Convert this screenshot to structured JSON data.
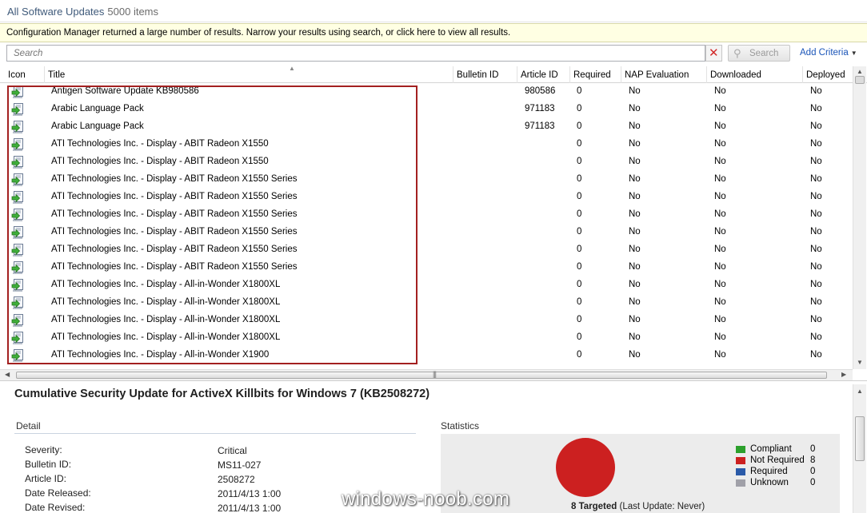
{
  "window": {
    "title": "All Software Updates",
    "count": "5000 items"
  },
  "infobar": {
    "text": "Configuration Manager returned a large number of results. Narrow your results using search, or click here to view all results."
  },
  "search": {
    "placeholder": "Search",
    "button_label": "Search",
    "add_criteria": "Add Criteria"
  },
  "columns": [
    "Icon",
    "Title",
    "Bulletin ID",
    "Article ID",
    "Required",
    "NAP Evaluation",
    "Downloaded",
    "Deployed"
  ],
  "rows": [
    {
      "title": "Antigen Software Update KB980586",
      "bulletin": "",
      "article": "980586",
      "required": "0",
      "nap": "No",
      "downloaded": "No",
      "deployed": "No"
    },
    {
      "title": "Arabic Language Pack",
      "bulletin": "",
      "article": "971183",
      "required": "0",
      "nap": "No",
      "downloaded": "No",
      "deployed": "No"
    },
    {
      "title": "Arabic Language Pack",
      "bulletin": "",
      "article": "971183",
      "required": "0",
      "nap": "No",
      "downloaded": "No",
      "deployed": "No"
    },
    {
      "title": "ATI Technologies Inc. - Display - ABIT Radeon X1550",
      "bulletin": "",
      "article": "",
      "required": "0",
      "nap": "No",
      "downloaded": "No",
      "deployed": "No"
    },
    {
      "title": "ATI Technologies Inc. - Display - ABIT Radeon X1550",
      "bulletin": "",
      "article": "",
      "required": "0",
      "nap": "No",
      "downloaded": "No",
      "deployed": "No"
    },
    {
      "title": "ATI Technologies Inc. - Display - ABIT Radeon X1550 Series",
      "bulletin": "",
      "article": "",
      "required": "0",
      "nap": "No",
      "downloaded": "No",
      "deployed": "No"
    },
    {
      "title": "ATI Technologies Inc. - Display - ABIT Radeon X1550 Series",
      "bulletin": "",
      "article": "",
      "required": "0",
      "nap": "No",
      "downloaded": "No",
      "deployed": "No"
    },
    {
      "title": "ATI Technologies Inc. - Display - ABIT Radeon X1550 Series",
      "bulletin": "",
      "article": "",
      "required": "0",
      "nap": "No",
      "downloaded": "No",
      "deployed": "No"
    },
    {
      "title": "ATI Technologies Inc. - Display - ABIT Radeon X1550 Series",
      "bulletin": "",
      "article": "",
      "required": "0",
      "nap": "No",
      "downloaded": "No",
      "deployed": "No"
    },
    {
      "title": "ATI Technologies Inc. - Display - ABIT Radeon X1550 Series",
      "bulletin": "",
      "article": "",
      "required": "0",
      "nap": "No",
      "downloaded": "No",
      "deployed": "No"
    },
    {
      "title": "ATI Technologies Inc. - Display - ABIT Radeon X1550 Series",
      "bulletin": "",
      "article": "",
      "required": "0",
      "nap": "No",
      "downloaded": "No",
      "deployed": "No"
    },
    {
      "title": "ATI Technologies Inc. - Display - All-in-Wonder X1800XL",
      "bulletin": "",
      "article": "",
      "required": "0",
      "nap": "No",
      "downloaded": "No",
      "deployed": "No"
    },
    {
      "title": "ATI Technologies Inc. - Display - All-in-Wonder X1800XL",
      "bulletin": "",
      "article": "",
      "required": "0",
      "nap": "No",
      "downloaded": "No",
      "deployed": "No"
    },
    {
      "title": "ATI Technologies Inc. - Display - All-in-Wonder X1800XL",
      "bulletin": "",
      "article": "",
      "required": "0",
      "nap": "No",
      "downloaded": "No",
      "deployed": "No"
    },
    {
      "title": "ATI Technologies Inc. - Display - All-in-Wonder X1800XL",
      "bulletin": "",
      "article": "",
      "required": "0",
      "nap": "No",
      "downloaded": "No",
      "deployed": "No"
    },
    {
      "title": "ATI Technologies Inc. - Display - All-in-Wonder X1900",
      "bulletin": "",
      "article": "",
      "required": "0",
      "nap": "No",
      "downloaded": "No",
      "deployed": "No"
    }
  ],
  "row_icon": "software-update-icon",
  "details": {
    "title": "Cumulative Security Update for ActiveX Killbits for Windows 7 (KB2508272)",
    "detail_heading": "Detail",
    "statistics_heading": "Statistics",
    "fields": [
      {
        "label": "Severity:",
        "value": "Critical"
      },
      {
        "label": "Bulletin ID:",
        "value": "MS11-027"
      },
      {
        "label": "Article ID:",
        "value": "2508272"
      },
      {
        "label": "Date Released:",
        "value": "2011/4/13 1:00"
      },
      {
        "label": "Date Revised:",
        "value": "2011/4/13 1:00"
      }
    ],
    "stats": {
      "legend": [
        {
          "label": "Compliant",
          "value": "0",
          "color": "#2ca02c"
        },
        {
          "label": "Not Required",
          "value": "8",
          "color": "#cc2020"
        },
        {
          "label": "Required",
          "value": "0",
          "color": "#2a5aa8"
        },
        {
          "label": "Unknown",
          "value": "0",
          "color": "#a0a0a8"
        }
      ],
      "targeted": "8 Targeted",
      "last_update": "(Last Update: Never)"
    }
  },
  "watermark": "windows-noob.com"
}
